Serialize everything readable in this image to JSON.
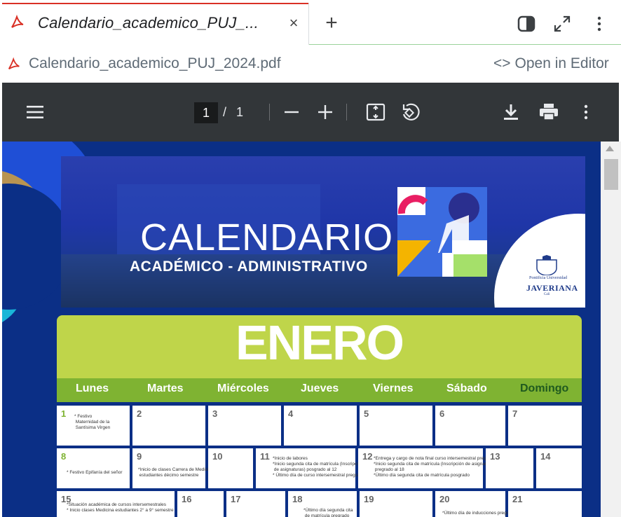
{
  "tab": {
    "title": "Calendario_academico_PUJ_...",
    "close": "×",
    "new_tab": "+"
  },
  "file": {
    "name": "Calendario_academico_PUJ_2024.pdf",
    "open_editor_code": "<>",
    "open_editor": "Open in Editor"
  },
  "pdf_toolbar": {
    "current_page": "1",
    "separator": "/",
    "total_pages": "1"
  },
  "document": {
    "banner_title": "CALENDARIO",
    "banner_subtitle": "ACADÉMICO - ADMINISTRATIVO",
    "university_top": "Pontificia Universidad",
    "university_name": "JAVERIANA",
    "university_city": "Cali",
    "month": "ENERO",
    "weekdays": [
      "Lunes",
      "Martes",
      "Miércoles",
      "Jueves",
      "Viernes",
      "Sábado",
      "Domingo"
    ],
    "days": [
      {
        "num": "1",
        "note": "* Festivo\n Maternidad de la\n Santísima Virgen"
      },
      {
        "num": "2",
        "note": ""
      },
      {
        "num": "3",
        "note": ""
      },
      {
        "num": "4",
        "note": ""
      },
      {
        "num": "5",
        "note": ""
      },
      {
        "num": "6",
        "note": ""
      },
      {
        "num": "7",
        "note": ""
      },
      {
        "num": "8",
        "note": "* Festivo Epifanía del señor"
      },
      {
        "num": "9",
        "note": "*Inicio de clases Carrera de Medicina\n estudiantes décimo semestre"
      },
      {
        "num": "10",
        "note": ""
      },
      {
        "num": "11",
        "note": "*Inicio de labores\n*Inicio segunda cita de matrícula (Inscripción\n de asignaturas) posgrado al 12\n* Último día de curso intersemestral pregrado"
      },
      {
        "num": "12",
        "note": "*Entrega y cargo de nota final curso intersemestral pregrado\n*Inicio segunda cita de matrícula (Inscripción de asignaturas)\n pregrado al 18\n*Último día segunda cita de matrícula posgrado"
      },
      {
        "num": "13",
        "note": ""
      },
      {
        "num": "14",
        "note": ""
      },
      {
        "num": "15",
        "note": "*Situación académica de cursos intersemestrales\n* Inicio clases Medicina estudiantes 2° a 9° semestre"
      },
      {
        "num": "16",
        "note": ""
      },
      {
        "num": "17",
        "note": ""
      },
      {
        "num": "18",
        "note": "*Último día segunda cita\n de matrícula pregrado"
      },
      {
        "num": "19",
        "note": ""
      },
      {
        "num": "20",
        "note": "*Último día de inducciones pregrado"
      },
      {
        "num": "21",
        "note": ""
      }
    ]
  },
  "colors": {
    "accent_red": "#d93025",
    "month_green": "#bfd54a",
    "weekday_green": "#7fb332",
    "page_blue": "#0b2f86"
  }
}
